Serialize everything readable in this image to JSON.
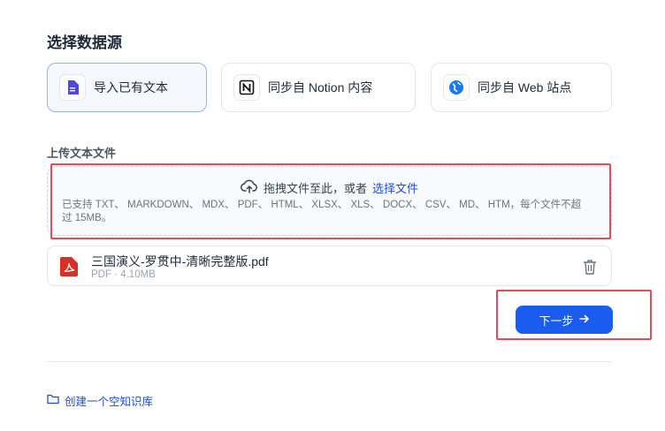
{
  "page": {
    "section_title": "选择数据源",
    "upload_title": "上传文本文件",
    "create_empty_label": "创建一个空知识库"
  },
  "sources": [
    {
      "label": "导入已有文本",
      "icon": "document-icon",
      "selected": true
    },
    {
      "label": "同步自 Notion 内容",
      "icon": "notion-icon",
      "selected": false
    },
    {
      "label": "同步自 Web 站点",
      "icon": "web-globe-icon",
      "selected": false
    }
  ],
  "dropzone": {
    "prompt": "拖拽文件至此，或者",
    "link": "选择文件",
    "support": "已支持 TXT、 MARKDOWN、 MDX、 PDF、 HTML、 XLSX、 XLS、 DOCX、 CSV、 MD、 HTM，每个文件不超过 15MB。"
  },
  "file": {
    "name": "三国演义-罗贯中-清晰完整版.pdf",
    "meta": "PDF · 4.10MB"
  },
  "actions": {
    "next_label": "下一步"
  },
  "colors": {
    "accent": "#1b5cf0",
    "highlight_annotation": "#e54b5a",
    "pdf_red": "#d93025"
  }
}
